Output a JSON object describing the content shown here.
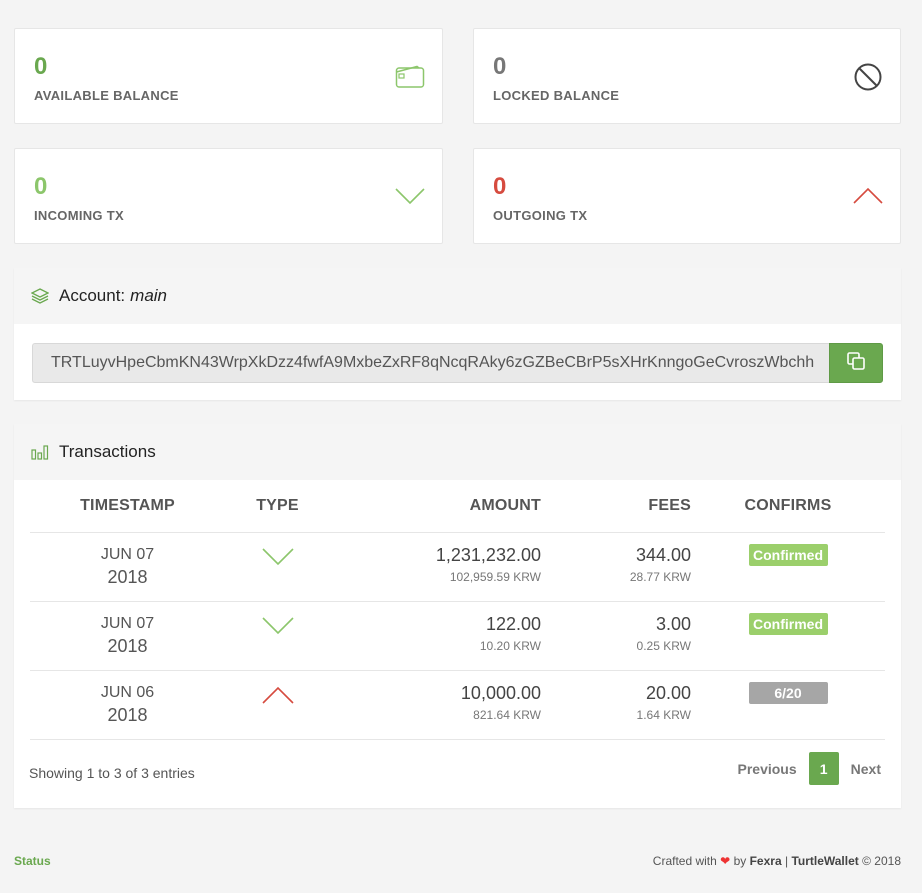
{
  "stats": {
    "available": {
      "value": "0",
      "label": "AVAILABLE BALANCE",
      "icon": "wallet-icon"
    },
    "locked": {
      "value": "0",
      "label": "LOCKED BALANCE",
      "icon": "ban-icon"
    },
    "incoming": {
      "value": "0",
      "label": "INCOMING TX",
      "icon": "chevron-down-icon"
    },
    "outgoing": {
      "value": "0",
      "label": "OUTGOING TX",
      "icon": "chevron-up-icon"
    }
  },
  "account": {
    "title": "Account:",
    "name": "main",
    "address": "TRTLuyvHpeCbmKN43WrpXkDzz4fwfA9MxbeZxRF8qNcqRAky6zGZBeCBrP5sXHrKnngoGeCvroszWbchh",
    "icon": "layers-icon",
    "copy_icon": "copy-icon"
  },
  "transactions": {
    "title": "Transactions",
    "icon": "bar-chart-icon",
    "columns": [
      "TIMESTAMP",
      "TYPE",
      "AMOUNT",
      "FEES",
      "CONFIRMS"
    ],
    "rows": [
      {
        "date": "JUN 07",
        "year": "2018",
        "type": "incoming",
        "amount": "1,231,232.00",
        "amount_krw": "102,959.59 KRW",
        "fee": "344.00",
        "fee_krw": "28.77 KRW",
        "status": "Confirmed"
      },
      {
        "date": "JUN 07",
        "year": "2018",
        "type": "incoming",
        "amount": "122.00",
        "amount_krw": "10.20 KRW",
        "fee": "3.00",
        "fee_krw": "0.25 KRW",
        "status": "Confirmed"
      },
      {
        "date": "JUN 06",
        "year": "2018",
        "type": "outgoing",
        "amount": "10,000.00",
        "amount_krw": "821.64 KRW",
        "fee": "20.00",
        "fee_krw": "1.64 KRW",
        "status": "6/20"
      }
    ],
    "showing": "Showing 1 to 3 of 3 entries",
    "pager": {
      "previous": "Previous",
      "current": "1",
      "next": "Next"
    }
  },
  "footer": {
    "status": "Status",
    "crafted": "Crafted with",
    "by": "by",
    "author": "Fexra",
    "sep": "|",
    "app": "TurtleWallet",
    "copyright": "© 2018"
  },
  "colors": {
    "accent": "#6aa84f",
    "light_green": "#8cc66b",
    "red": "#d64b3f",
    "confirmed": "#9bcf6b",
    "pending": "#a6a6a6"
  }
}
